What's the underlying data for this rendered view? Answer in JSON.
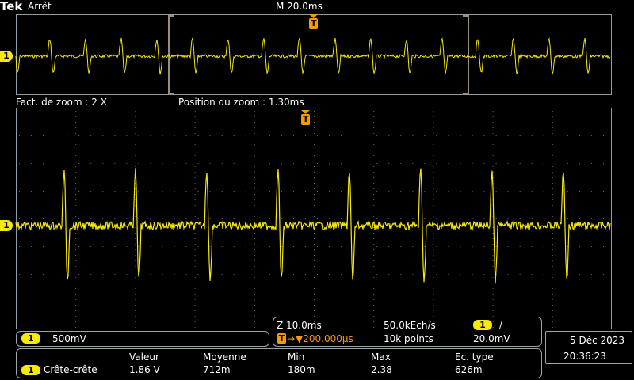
{
  "header": {
    "brand": "Tek",
    "run_state": "Arrêt",
    "timebase": "M 20.0ms"
  },
  "zoom_info": {
    "factor": "Fact. de zoom : 2 X",
    "position": "Position du zoom : 1.30ms"
  },
  "channel": {
    "number": "1",
    "scale": "500mV",
    "color": "#f5e80a"
  },
  "acquisition": {
    "zoom_timebase": "Z 10.0ms",
    "sample_rate": "50.0kEch/s",
    "trigger_position": "▼200.000µs",
    "record_length": "10k points",
    "trigger_channel": "1",
    "trigger_slope": "/",
    "trigger_level": "20.0mV"
  },
  "datetime": {
    "date": "5 Déc  2023",
    "time": "20:36:23"
  },
  "measurements": {
    "headers": [
      "Valeur",
      "Moyenne",
      "Min",
      "Max",
      "Ec. type"
    ],
    "rows": [
      {
        "channel": "1",
        "name": "Crête-crête",
        "values": [
          "1.86 V",
          "712m",
          "180m",
          "2.38",
          "626m"
        ]
      }
    ]
  },
  "trigger_marker_label": "T",
  "channel_marker_label": "1"
}
